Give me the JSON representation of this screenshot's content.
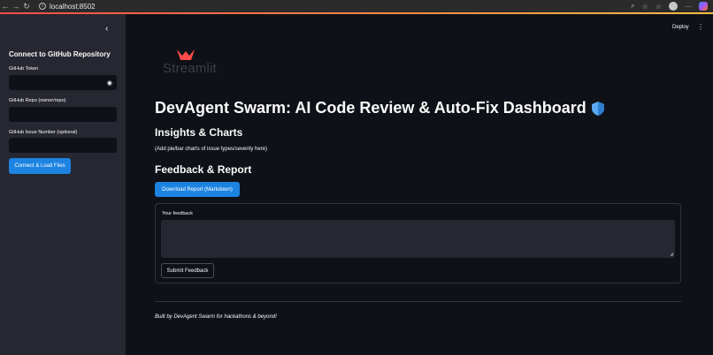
{
  "browser": {
    "url": "localhost:8502",
    "back_glyph": "←",
    "forward_glyph": "→",
    "reload_glyph": "↻",
    "info_glyph": "i",
    "zoom_glyph": "⌕",
    "star_glyph": "☆",
    "fav_glyph": "☆",
    "more_glyph": "···"
  },
  "sidebar": {
    "collapse_glyph": "‹",
    "title": "Connect to GitHub Repository",
    "fields": [
      {
        "label": "GitHub Token",
        "value": ""
      },
      {
        "label": "GitHub Repo (owner/repo)",
        "value": ""
      },
      {
        "label": "GitHub Issue Number (optional)",
        "value": ""
      }
    ],
    "eye_glyph": "◉",
    "connect_button": "Connect & Load Files"
  },
  "header": {
    "deploy_label": "Deploy",
    "menu_glyph": "⋮"
  },
  "logo": {
    "text": "Streamlit",
    "color": "#ff4b4b"
  },
  "main": {
    "title": "DevAgent Swarm: AI Code Review & Auto-Fix Dashboard",
    "insights_heading": "Insights & Charts",
    "insights_caption": "(Add pie/bar charts of issue types/severity here)",
    "feedback_heading": "Feedback & Report",
    "download_button": "Download Report (Markdown)",
    "feedback_label": "Your feedback",
    "feedback_value": "",
    "resize_glyph": "◢",
    "submit_button": "Submit Feedback",
    "footer": "Built by DevAgent Swarm for hackathons & beyond!"
  },
  "colors": {
    "accent": "#ff4b4b",
    "primary_button": "#1c83e1",
    "background": "#0e1117",
    "sidebar": "#262730"
  }
}
